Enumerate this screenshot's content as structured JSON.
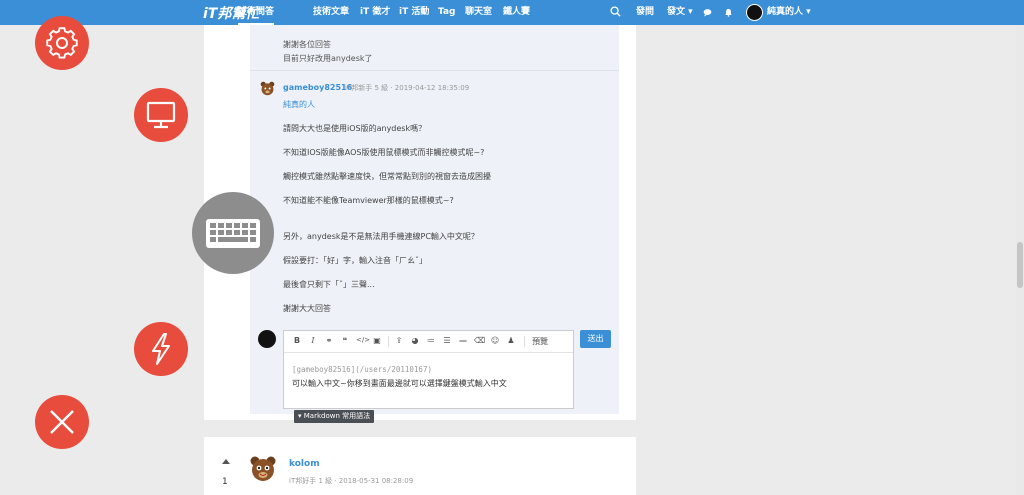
{
  "navbar": {
    "logo": "iT邦幫忙",
    "items": [
      "技術問答",
      "技術文章",
      "iT 徵才",
      "iT 活動",
      "Tag",
      "聊天室",
      "鐵人賽"
    ],
    "ask": "發問",
    "post": "發文",
    "user_name": "純真的人",
    "colors": {
      "bar": "#3a8fd6"
    }
  },
  "previous_comment": {
    "line1": "謝謝各位回答",
    "line2": "目前只好改用anydesk了"
  },
  "comment": {
    "author": "gameboy82516",
    "meta": "iT邦新手 5 級 ‧ 2019-04-12 18:35:09",
    "reply_to": "純真的人",
    "paragraphs": [
      "請問大大也是使用iOS版的anydesk嗎？",
      "不知道IOS版能像AOS版使用鼠標模式而非觸控模式呢~?",
      "觸控模式雖然點擊速度快，但常常點到別的視窗去造成困擾",
      "不知道能不能像Teamviewer那樣的鼠標模式~?",
      "另外，anydesk是不是無法用手機連線PC輸入中文呢？",
      "假設要打：「好」字，輸入注音「ㄏㄠˇ」",
      "最後會只剩下「ˇ」三聲...",
      "謝謝大大回答"
    ]
  },
  "editor": {
    "toolbar_icons": [
      "bold-icon",
      "italic-icon",
      "link-icon",
      "quote-icon",
      "code-icon",
      "image-icon",
      "upload-icon",
      "chart-icon",
      "ordered-list-icon",
      "list-icon",
      "hr-icon",
      "trash-icon",
      "emoji-icon",
      "user-icon"
    ],
    "preview": "預覽",
    "line1": "[gameboy82516](/users/20110167)",
    "line2": "可以輸入中文~你移到畫面最邊就可以選擇鍵盤模式輸入中文",
    "submit": "送出",
    "markdown_help": "▾ Markdown 常用語法"
  },
  "next_answer": {
    "vote_count": "1",
    "author": "kolom",
    "meta": "iT邦好手 1 級 ‧ 2018-05-31 08:28:09"
  },
  "floating_buttons": [
    "gear-icon",
    "monitor-icon",
    "keyboard-icon",
    "lightning-icon",
    "close-icon"
  ]
}
